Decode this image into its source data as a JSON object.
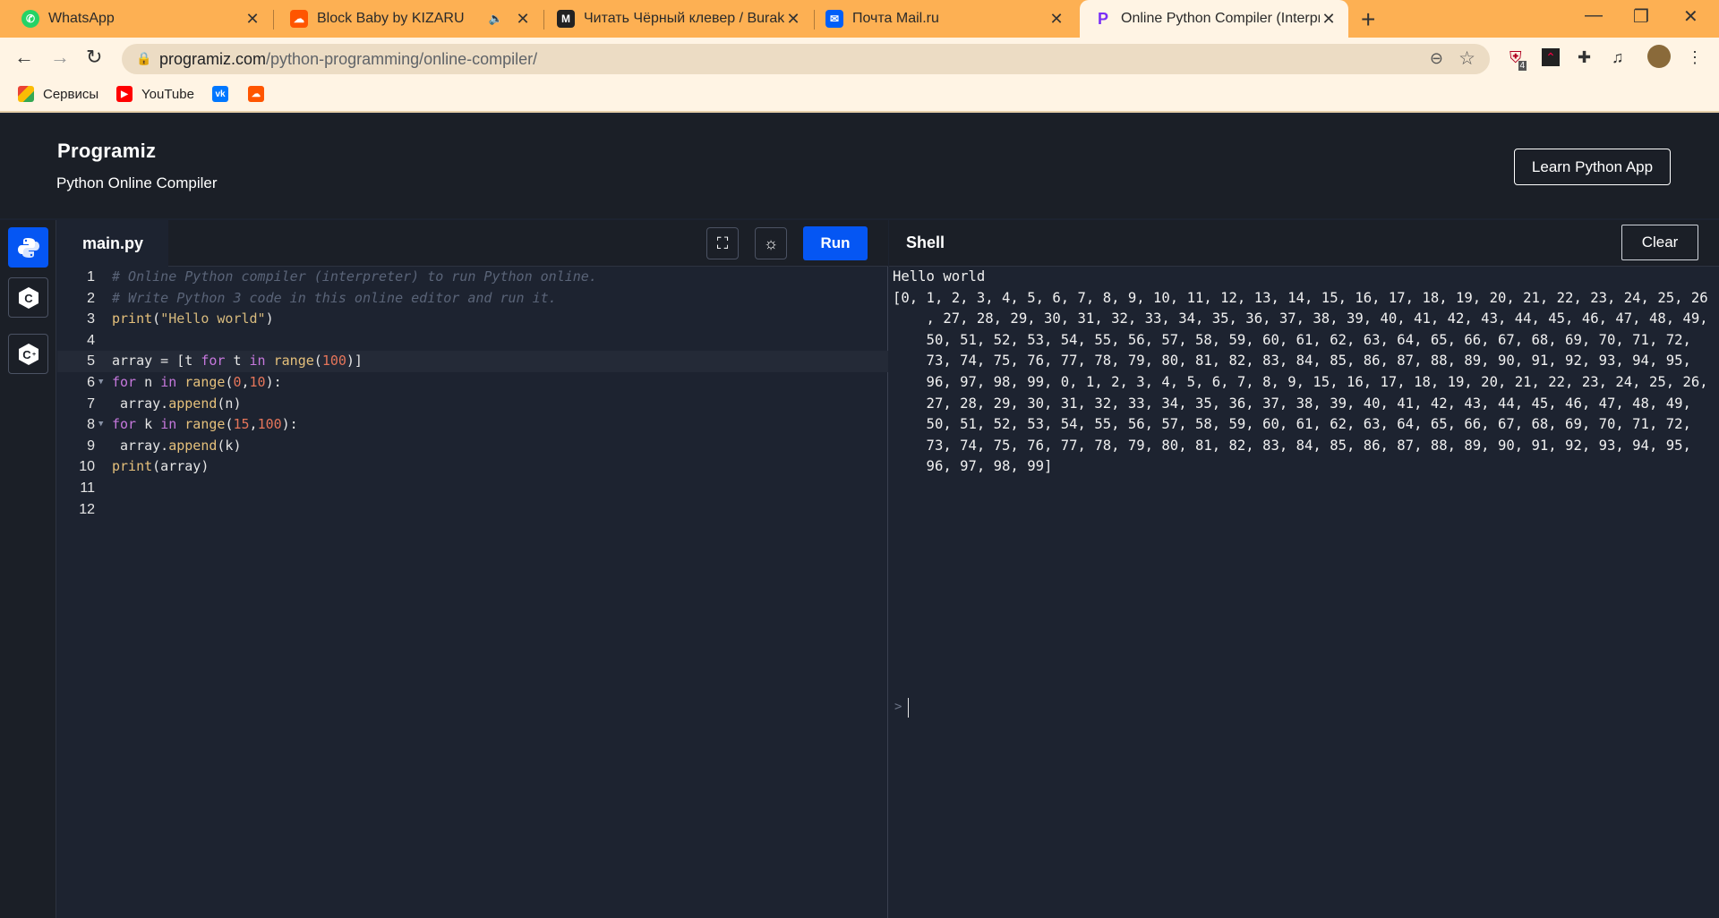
{
  "browser": {
    "tabs": [
      {
        "title": "WhatsApp",
        "icon": "whatsapp-icon",
        "color": "#25d366"
      },
      {
        "title": "Block Baby by KIZARU",
        "icon": "soundcloud-icon",
        "color": "#ff5500"
      },
      {
        "title": "Читать Чёрный клевер / Burakk",
        "icon": "manga-icon",
        "color": "#222222"
      },
      {
        "title": "Почта Mail.ru",
        "icon": "mail-icon",
        "color": "#005ff9"
      },
      {
        "title": "Online Python Compiler (Interpre",
        "icon": "programiz-icon",
        "color": "#7b2ff7"
      }
    ],
    "url_host": "programiz.com",
    "url_path": "/python-programming/online-compiler/",
    "bookmarks": [
      {
        "label": "Сервисы",
        "icon": "apps-grid-icon"
      },
      {
        "label": "YouTube",
        "icon": "youtube-icon"
      },
      {
        "label": "",
        "icon": "vk-icon"
      },
      {
        "label": "",
        "icon": "soundcloud-icon"
      }
    ],
    "extension_badge": "4"
  },
  "header": {
    "logo": "Programiz",
    "subtitle": "Python Online Compiler",
    "learn_button": "Learn Python App"
  },
  "editor": {
    "file_tab": "main.py",
    "run_label": "Run",
    "line_numbers": [
      "1",
      "2",
      "3",
      "4",
      "5",
      "6",
      "7",
      "8",
      "9",
      "10",
      "11",
      "12"
    ]
  },
  "shell": {
    "title": "Shell",
    "clear_label": "Clear",
    "output_lines": [
      "Hello world",
      "[0, 1, 2, 3, 4, 5, 6, 7, 8, 9, 10, 11, 12, 13, 14, 15, 16, 17, 18, 19, 20, 21, 22, 23, 24, 25, 26",
      "    , 27, 28, 29, 30, 31, 32, 33, 34, 35, 36, 37, 38, 39, 40, 41, 42, 43, 44, 45, 46, 47, 48, 49,",
      "    50, 51, 52, 53, 54, 55, 56, 57, 58, 59, 60, 61, 62, 63, 64, 65, 66, 67, 68, 69, 70, 71, 72,",
      "    73, 74, 75, 76, 77, 78, 79, 80, 81, 82, 83, 84, 85, 86, 87, 88, 89, 90, 91, 92, 93, 94, 95,",
      "    96, 97, 98, 99, 0, 1, 2, 3, 4, 5, 6, 7, 8, 9, 15, 16, 17, 18, 19, 20, 21, 22, 23, 24, 25, 26,",
      "    27, 28, 29, 30, 31, 32, 33, 34, 35, 36, 37, 38, 39, 40, 41, 42, 43, 44, 45, 46, 47, 48, 49,",
      "    50, 51, 52, 53, 54, 55, 56, 57, 58, 59, 60, 61, 62, 63, 64, 65, 66, 67, 68, 69, 70, 71, 72,",
      "    73, 74, 75, 76, 77, 78, 79, 80, 81, 82, 83, 84, 85, 86, 87, 88, 89, 90, 91, 92, 93, 94, 95,",
      "    96, 97, 98, 99]"
    ],
    "prompt": ">"
  },
  "colors": {
    "accent": "#0556f3",
    "tabbar": "#fdb053",
    "header_bg": "#1b1f27",
    "editor_bg": "#1d2330"
  }
}
